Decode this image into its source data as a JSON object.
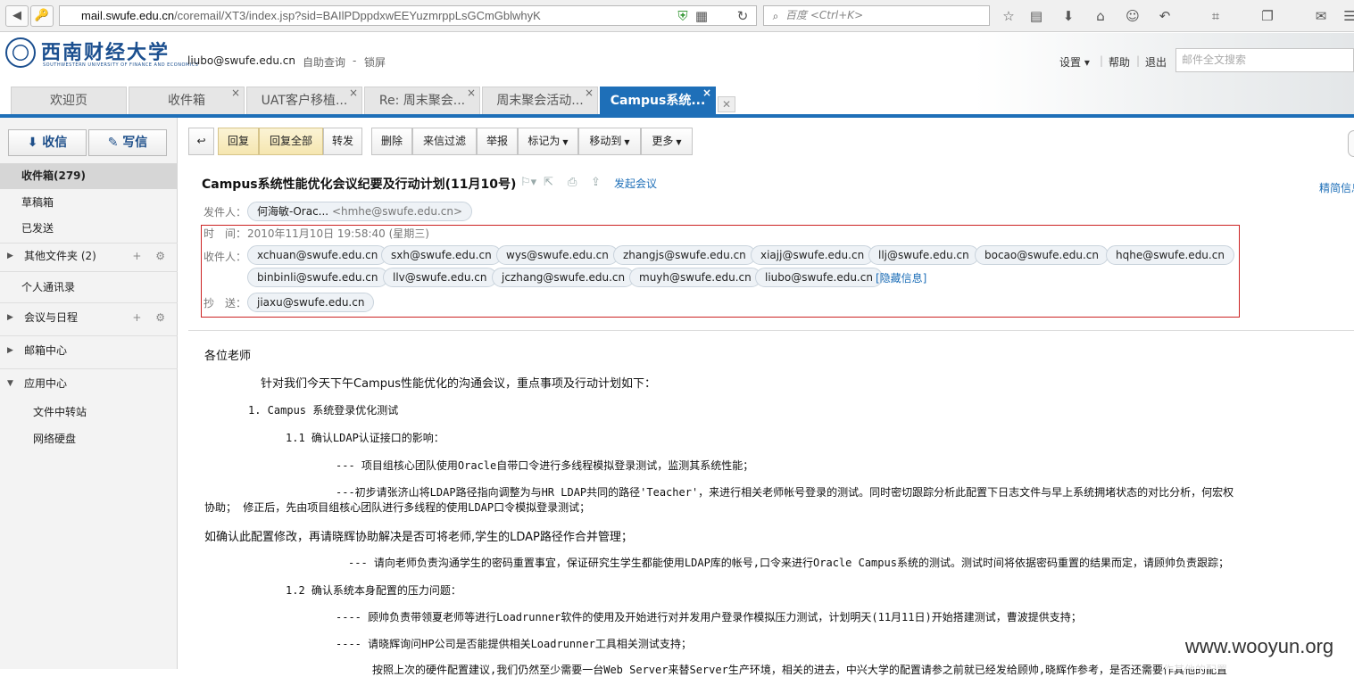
{
  "browser": {
    "url_host": "mail.swufe.edu.cn",
    "url_rest": "/coremail/XT3/index.jsp?sid=BAIlPDppdxwEEYuzmrppLsGCmGblwhyK",
    "search_placeholder": "百度 <Ctrl+K>"
  },
  "header": {
    "logo_cn": "西南财经大学",
    "logo_en": "SOUTHWESTERN UNIVERSITY OF FINANCE AND ECONOMICS",
    "user_email": "liubo@swufe.edu.cn",
    "self_help": "自助查询",
    "dash": "-",
    "lock": "锁屏",
    "settings": "设置 ▾",
    "help": "帮助",
    "logout": "退出",
    "sep": "|",
    "mail_search_placeholder": "邮件全文搜索"
  },
  "tabs": [
    {
      "label": "欢迎页"
    },
    {
      "label": "收件箱"
    },
    {
      "label": "UAT客户移植..."
    },
    {
      "label": "Re: 周末聚会..."
    },
    {
      "label": "周末聚会活动..."
    },
    {
      "label": "Campus系统..."
    }
  ],
  "sidebar": {
    "receive": "收信",
    "compose": "写信",
    "items": [
      {
        "label": "收件箱(279)"
      },
      {
        "label": "草稿箱"
      },
      {
        "label": "已发送"
      },
      {
        "label": "其他文件夹 (2)"
      },
      {
        "label": "个人通讯录"
      },
      {
        "label": "会议与日程"
      },
      {
        "label": "邮箱中心"
      },
      {
        "label": "应用中心"
      },
      {
        "label": "文件中转站"
      },
      {
        "label": "网络硬盘"
      }
    ]
  },
  "toolbar": {
    "reply": "回复",
    "reply_all": "回复全部",
    "forward": "转发",
    "delete": "删除",
    "filter": "来信过滤",
    "report": "举报",
    "mark_as": "标记为",
    "move_to": "移动到",
    "more": "更多"
  },
  "message": {
    "subject": "Campus系统性能优化会议纪要及行动计划(11月10号)",
    "start_meeting": "发起会议",
    "simple_view": "精简信息",
    "from_label": "发件人：",
    "from_name": "何海敏-Orac...",
    "from_addr": "<hmhe@swufe.edu.cn>",
    "time_label": "时　间：",
    "time_value": "2010年11月10日 19:58:40 (星期三)",
    "to_label": "收件人：",
    "to": [
      "xchuan@swufe.edu.cn",
      "sxh@swufe.edu.cn",
      "wys@swufe.edu.cn",
      "zhangjs@swufe.edu.cn",
      "xiajj@swufe.edu.cn",
      "llj@swufe.edu.cn",
      "bocao@swufe.edu.cn",
      "hqhe@swufe.edu.cn",
      "binbinli@swufe.edu.cn",
      "llv@swufe.edu.cn",
      "jczhang@swufe.edu.cn",
      "muyh@swufe.edu.cn",
      "liubo@swufe.edu.cn"
    ],
    "hide_info": "[隐藏信息]",
    "cc_label": "抄　送：",
    "cc": [
      "jiaxu@swufe.edu.cn"
    ]
  },
  "body": {
    "lines": [
      "各位老师",
      "针对我们今天下午Campus性能优化的沟通会议，重点事项及行动计划如下：",
      "1.  Campus 系统登录优化测试",
      "1.1 确认LDAP认证接口的影响：",
      "--- 项目组核心团队使用Oracle自带口令进行多线程模拟登录测试，监测其系统性能；",
      "---初步请张济山将LDAP路径指向调整为与HR LDAP共同的路径'Teacher'，来进行相关老师帐号登录的测试。同时密切跟踪分析此配置下日志文件与早上系统拥堵状态的对比分析，何宏权",
      "协助；   修正后，先由项目组核心团队进行多线程的使用LDAP口令模拟登录测试；",
      "如确认此配置修改，再请晓辉协助解决是否可将老师,学生的LDAP路径作合并管理；",
      "--- 请向老师负责沟通学生的密码重置事宜，保证研究生学生都能使用LDAP库的帐号,口令来进行Oracle Campus系统的测试。测试时间将依据密码重置的结果而定，请顾帅负责跟踪；",
      "1.2 确认系统本身配置的压力问题：",
      "---- 顾帅负责带领夏老师等进行Loadrunner软件的使用及开始进行对并发用户登录作模拟压力测试，计划明天(11月11日)开始搭建测试，曹波提供支持；",
      "----  请晓辉询问HP公司是否能提供相关Loadrunner工具相关测试支持；",
      "按照上次的硬件配置建议,我们仍然至少需要一台Web Server来替Server生产环境，相关的进去，中兴大学的配置请参之前就已经发给顾帅,晓辉作参考，是否还需要作其他的配置"
    ]
  },
  "watermark": "www.wooyun.org"
}
